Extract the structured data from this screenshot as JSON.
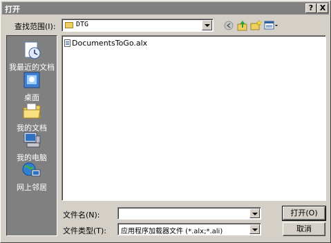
{
  "window": {
    "title": "打开",
    "help_glyph": "?",
    "close_glyph": "X"
  },
  "lookin": {
    "label": "查找范围(I):",
    "value": "DTG"
  },
  "places": [
    {
      "label": "我最近的文档",
      "icon": "recent-documents-icon"
    },
    {
      "label": "桌面",
      "icon": "desktop-icon"
    },
    {
      "label": "我的文档",
      "icon": "my-documents-icon"
    },
    {
      "label": "我的电脑",
      "icon": "my-computer-icon"
    },
    {
      "label": "网上邻居",
      "icon": "network-places-icon"
    }
  ],
  "files": [
    {
      "name": "DocumentsToGo.alx"
    }
  ],
  "filename": {
    "label": "文件名(N):",
    "value": ""
  },
  "filetype": {
    "label": "文件类型(T):",
    "value": "应用程序加载器文件 (*.alx;*.ali)"
  },
  "buttons": {
    "open": "打开(O)",
    "cancel": "取消"
  },
  "colors": {
    "places_bg": "#808080",
    "dialog_bg": "#d4d0c8",
    "titlebar": "#808080"
  }
}
